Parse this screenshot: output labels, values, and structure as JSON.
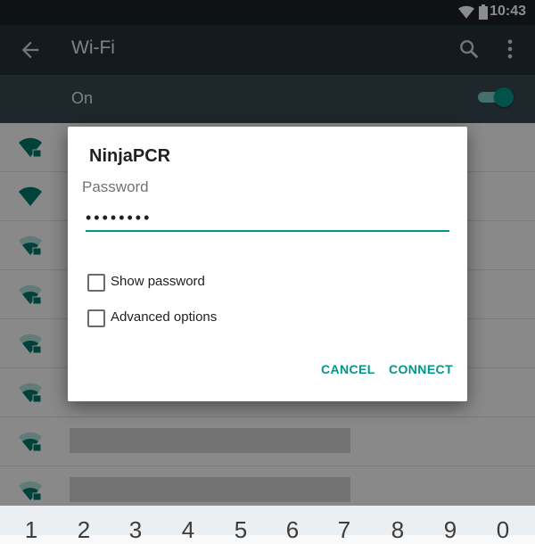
{
  "status_bar": {
    "time": "10:43"
  },
  "app_bar": {
    "title": "Wi-Fi"
  },
  "wifi_switch": {
    "label": "On",
    "on": true
  },
  "dialog": {
    "title": "NinjaPCR",
    "password_label": "Password",
    "password_value": "••••••••",
    "show_password_label": "Show password",
    "advanced_options_label": "Advanced options",
    "cancel_label": "CANCEL",
    "connect_label": "CONNECT"
  },
  "network_rows": [
    {
      "ssid": "",
      "locked": true,
      "signal": "full"
    },
    {
      "ssid": "",
      "locked": false,
      "signal": "full"
    },
    {
      "ssid": "",
      "locked": true,
      "signal": "medium"
    },
    {
      "ssid": "",
      "locked": true,
      "signal": "medium"
    },
    {
      "ssid": "",
      "locked": true,
      "signal": "medium"
    },
    {
      "ssid": ".",
      "locked": true,
      "signal": "medium"
    },
    {
      "ssid": "",
      "locked": true,
      "signal": "medium",
      "redacted": true
    },
    {
      "ssid": "",
      "locked": true,
      "signal": "medium",
      "redacted": true
    }
  ],
  "keyboard": {
    "number_keys": [
      "1",
      "2",
      "3",
      "4",
      "5",
      "6",
      "7",
      "8",
      "9",
      "0"
    ]
  },
  "colors": {
    "accent": "#009688",
    "app_bar": "#263238",
    "switch_bar": "#37474f"
  }
}
